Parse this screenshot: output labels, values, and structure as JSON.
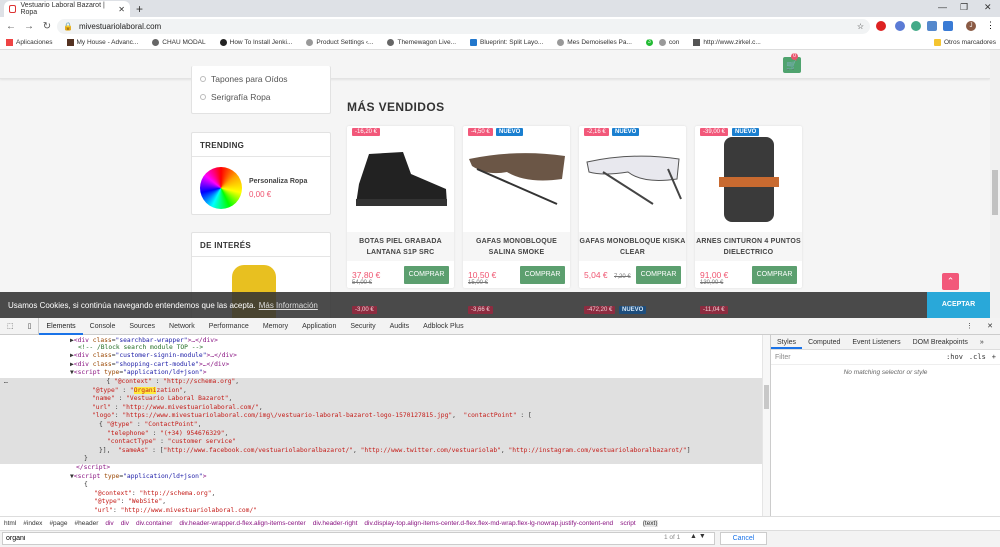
{
  "browser": {
    "tab_title": "Vestuario Laboral Bazarot | Ropa",
    "url": "mivestuariolaboral.com",
    "bookmarks": [
      "Aplicaciones",
      "My House - Advanc...",
      "CHAU MODAL",
      "How To Install Jenki...",
      "Product Settings ‹...",
      "Themewagon Live...",
      "Blueprint: Split Layo...",
      "Mes Demoiselles Pa...",
      "3",
      "con",
      "http://www.zirkel.c..."
    ],
    "other_bookmarks": "Otros marcadores",
    "profile_initial": "J"
  },
  "page": {
    "cart_count": "0",
    "categories": [
      "Tapones para Oídos",
      "Serigrafía Ropa"
    ],
    "trending": {
      "title": "TRENDING",
      "product": "Personaliza Ropa",
      "price": "0,00 €"
    },
    "interest": {
      "title": "DE INTERÉS"
    },
    "bestsellers_title": "MÁS VENDIDOS",
    "products": [
      {
        "discount": "-16,20 €",
        "new": "",
        "name": "BOTAS PIEL GRABADA LANTANA S1P SRC",
        "price": "37,80 €",
        "old_price": "54,00 €",
        "buy": "COMPRAR"
      },
      {
        "discount": "-4,50 €",
        "new": "NUEVO",
        "name": "GAFAS MONOBLOQUE SALINA SMOKE",
        "price": "10,50 €",
        "old_price": "15,00 €",
        "buy": "COMPRAR"
      },
      {
        "discount": "-2,16 €",
        "new": "NUEVO",
        "name": "GAFAS MONOBLOQUE KISKA CLEAR",
        "price": "5,04 €",
        "old_price": "7,20 €",
        "buy": "COMPRAR"
      },
      {
        "discount": "-39,00 €",
        "new": "NUEVO",
        "name": "ARNES CINTURON 4 PUNTOS DIELECTRICO",
        "price": "91,00 €",
        "old_price": "130,00 €",
        "buy": "COMPRAR"
      }
    ],
    "row2": [
      {
        "discount": "-3,00 €",
        "new": ""
      },
      {
        "discount": "-3,66 €",
        "new": ""
      },
      {
        "discount": "-472,20 €",
        "new": "NUEVO"
      },
      {
        "discount": "-11,04 €",
        "new": ""
      }
    ],
    "cookie": {
      "text": "Usamos Cookies, si continúa navegando entendemos que las acepta.",
      "link": "Más Información",
      "accept": "ACEPTAR"
    }
  },
  "devtools": {
    "tabs": [
      "Elements",
      "Console",
      "Sources",
      "Network",
      "Performance",
      "Memory",
      "Application",
      "Security",
      "Audits",
      "Adblock Plus"
    ],
    "side_tabs": [
      "Styles",
      "Computed",
      "Event Listeners",
      "DOM Breakpoints"
    ],
    "filter_placeholder": "Filter",
    "hov": ":hov",
    "cls": ".cls",
    "no_match": "No matching selector or style",
    "breadcrumbs": [
      "html",
      "#index",
      "#page",
      "#header",
      "div",
      "div",
      "div.container",
      "div.header-wrapper.d-flex.align-items-center",
      "div.header-right",
      "div.display-top.align-items-center.d-flex.flex-md-wrap.flex-lg-nowrap.justify-content-end",
      "script",
      "(text)"
    ],
    "search": {
      "value": "organi",
      "count": "1 of 1",
      "cancel": "Cancel"
    }
  }
}
